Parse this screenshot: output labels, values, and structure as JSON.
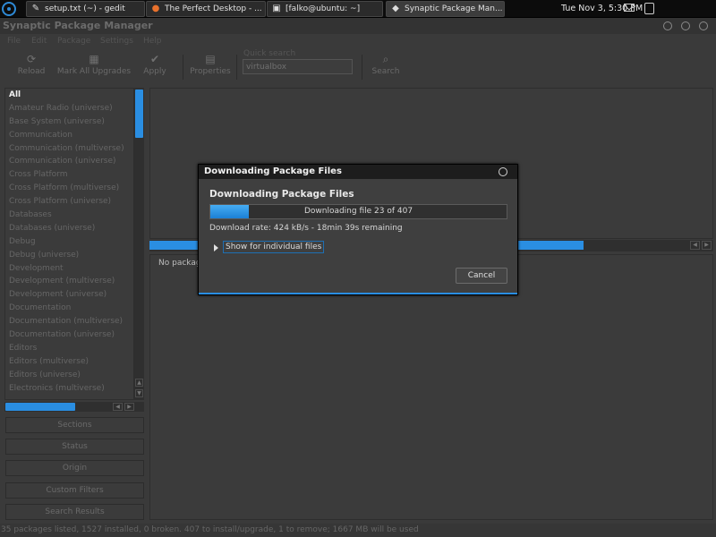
{
  "taskbar": {
    "tasks": [
      {
        "label": "setup.txt (~) - gedit",
        "icon": "text-editor-icon"
      },
      {
        "label": "The Perfect Desktop - ...",
        "icon": "firefox-icon"
      },
      {
        "label": "[falko@ubuntu: ~]",
        "icon": "terminal-icon"
      },
      {
        "label": "Synaptic Package Man...",
        "icon": "synaptic-icon"
      }
    ],
    "clock": "Tue Nov 3, 5:30 PM"
  },
  "window": {
    "title": "Synaptic Package Manager"
  },
  "menu": [
    "File",
    "Edit",
    "Package",
    "Settings",
    "Help"
  ],
  "toolbar": {
    "reload": "Reload",
    "mark_all_upgrades": "Mark All Upgrades",
    "apply": "Apply",
    "properties": "Properties",
    "quick_search_label": "Quick search",
    "quick_search_value": "virtualbox",
    "search": "Search"
  },
  "sections": [
    "All",
    "Amateur Radio (universe)",
    "Base System (universe)",
    "Communication",
    "Communication (multiverse)",
    "Communication (universe)",
    "Cross Platform",
    "Cross Platform (multiverse)",
    "Cross Platform (universe)",
    "Databases",
    "Databases (universe)",
    "Debug",
    "Debug (universe)",
    "Development",
    "Development (multiverse)",
    "Development (universe)",
    "Documentation",
    "Documentation (multiverse)",
    "Documentation (universe)",
    "Editors",
    "Editors (multiverse)",
    "Editors (universe)",
    "Electronics (multiverse)"
  ],
  "side_buttons": {
    "sections": "Sections",
    "status": "Status",
    "origin": "Origin",
    "custom_filters": "Custom Filters",
    "search_results": "Search Results"
  },
  "description": {
    "text": "No packag"
  },
  "statusbar": "35 packages listed, 1527 installed, 0 broken. 407 to install/upgrade, 1 to remove; 1667 MB will be used",
  "dialog": {
    "title": "Downloading Package Files",
    "heading": "Downloading Package Files",
    "progress_text": "Downloading file 23 of 407",
    "progress_fraction": 0.13,
    "rate": "Download rate: 424 kB/s - 18min 39s remaining",
    "expander": "Show for individual files",
    "cancel": "Cancel"
  },
  "colors": {
    "accent": "#2a8ee2",
    "panel": "#0c0c0c",
    "window_bg": "#3a3a3a"
  }
}
